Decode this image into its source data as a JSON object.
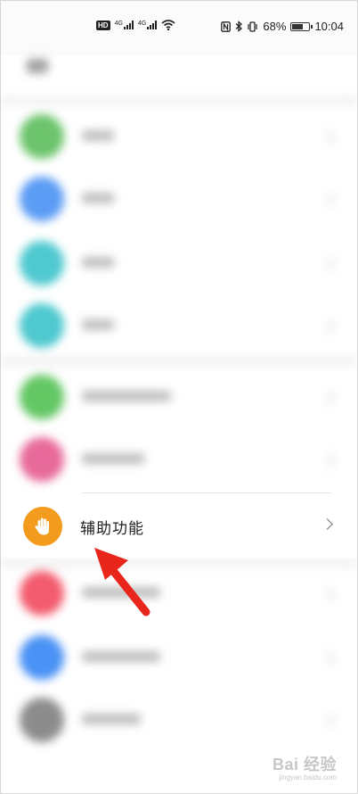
{
  "status_bar": {
    "hd_badge": "HD",
    "sim1_label": "4G",
    "sim2_label": "4G",
    "battery_percent": "68%",
    "battery_level": 0.68,
    "time": "10:04",
    "icons": [
      "hd-icon",
      "signal-icon",
      "signal-icon",
      "wifi-icon",
      "nfc-icon",
      "bluetooth-icon",
      "vibrate-icon",
      "battery-icon"
    ]
  },
  "settings_list": {
    "highlighted_item": {
      "label": "辅助功能",
      "icon": "hand-icon",
      "icon_color": "#f29b1d"
    },
    "blurred_icon_colors": [
      "#6cc46c",
      "#5b9cf5",
      "#4ec9cf",
      "#4ec9cf",
      "#63c764",
      "#e86a9a",
      "#f35b6e",
      "#4a92f5",
      "#8c8c8c"
    ]
  },
  "annotation": {
    "arrow_color": "#e8261c"
  },
  "watermark": {
    "brand": "Bai 经验",
    "url": "jingyan.baidu.com"
  }
}
